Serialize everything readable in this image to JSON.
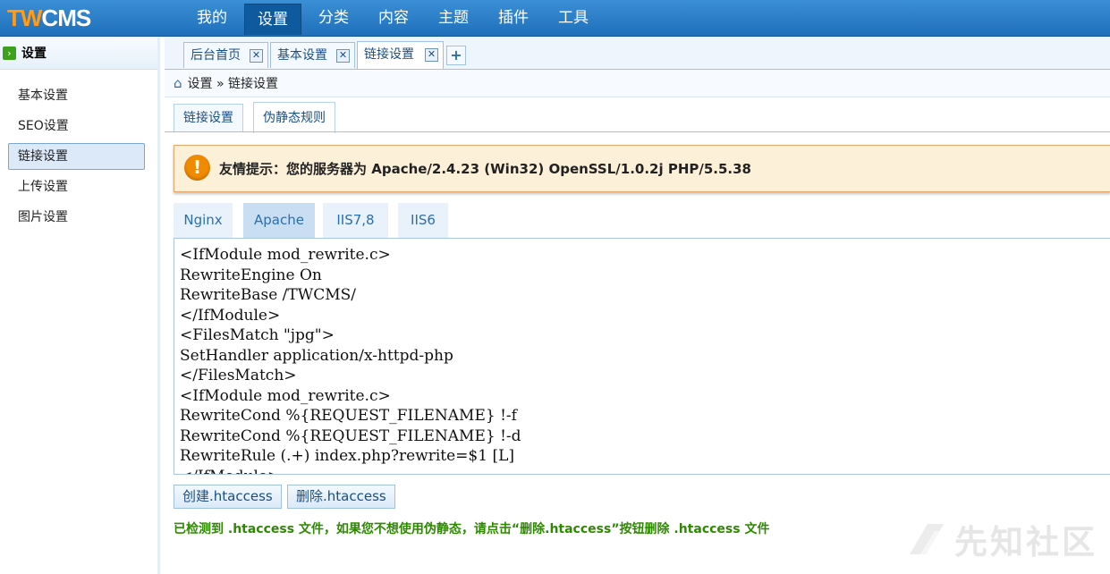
{
  "app": {
    "logo_part1": "TW",
    "logo_part2": "CMS",
    "accent_color": "#1f6fba",
    "logo_color": "#ff9c1a"
  },
  "topnav": {
    "items": [
      {
        "label": "我的",
        "active": false
      },
      {
        "label": "设置",
        "active": true
      },
      {
        "label": "分类",
        "active": false
      },
      {
        "label": "内容",
        "active": false
      },
      {
        "label": "主题",
        "active": false
      },
      {
        "label": "插件",
        "active": false
      },
      {
        "label": "工具",
        "active": false
      }
    ]
  },
  "sidebar": {
    "title": "设置",
    "title_icon": "chevron-right-icon",
    "items": [
      {
        "label": "基本设置",
        "active": false
      },
      {
        "label": "SEO设置",
        "active": false
      },
      {
        "label": "链接设置",
        "active": true
      },
      {
        "label": "上传设置",
        "active": false
      },
      {
        "label": "图片设置",
        "active": false
      }
    ]
  },
  "tabs": {
    "items": [
      {
        "label": "后台首页",
        "close": "✕",
        "active": false
      },
      {
        "label": "基本设置",
        "close": "✕",
        "active": false
      },
      {
        "label": "链接设置",
        "close": "✕",
        "active": true
      }
    ],
    "add_label": "+"
  },
  "breadcrumb": {
    "home_icon": "home-icon",
    "text": "设置 » 链接设置"
  },
  "subtabs": [
    {
      "label": "链接设置",
      "active": false
    },
    {
      "label": "伪静态规则",
      "active": true
    }
  ],
  "notice": {
    "icon": "warning-icon",
    "icon_glyph": "!",
    "text": "友情提示：您的服务器为 Apache/2.4.23 (Win32) OpenSSL/1.0.2j PHP/5.5.38"
  },
  "server_tabs": [
    {
      "label": "Nginx",
      "active": false
    },
    {
      "label": "Apache",
      "active": true
    },
    {
      "label": "IIS7,8",
      "active": false
    },
    {
      "label": "IIS6",
      "active": false
    }
  ],
  "rules_code": [
    "<IfModule mod_rewrite.c>",
    "RewriteEngine On",
    "RewriteBase /TWCMS/",
    "</IfModule>",
    "<FilesMatch \"jpg\">",
    "SetHandler application/x-httpd-php",
    "</FilesMatch>",
    "<IfModule mod_rewrite.c>",
    "RewriteCond %{REQUEST_FILENAME} !-f",
    "RewriteCond %{REQUEST_FILENAME} !-d",
    "RewriteRule (.+) index.php?rewrite=$1 [L]",
    "</IfModule>"
  ],
  "buttons": {
    "create_label": "创建.htaccess",
    "delete_label": "删除.htaccess"
  },
  "status": {
    "text": "已检测到 .htaccess 文件，如果您不想使用伪静态，请点击“删除.htaccess”按钮删除 .htaccess 文件",
    "color": "#2d8a00"
  },
  "watermark": {
    "text": "先知社区"
  }
}
